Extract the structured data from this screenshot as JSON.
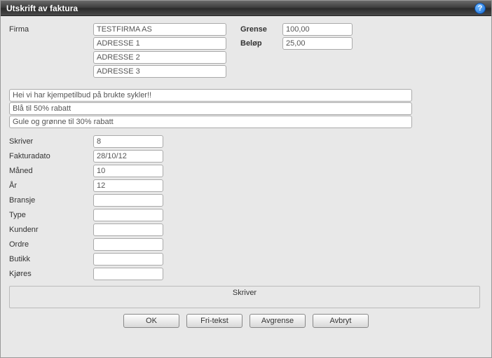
{
  "title": "Utskrift av faktura",
  "help": "?",
  "labels": {
    "firma": "Firma",
    "grense": "Grense",
    "belop": "Beløp",
    "skriver": "Skriver",
    "fakturadato": "Fakturadato",
    "maned": "Måned",
    "ar": "År",
    "bransje": "Bransje",
    "type": "Type",
    "kundenr": "Kundenr",
    "ordre": "Ordre",
    "butikk": "Butikk",
    "kjores": "Kjøres"
  },
  "values": {
    "firma": "TESTFIRMA AS",
    "adresse1": "ADRESSE 1",
    "adresse2": "ADRESSE 2",
    "adresse3": "ADRESSE 3",
    "grense": "100,00",
    "belop": "25,00",
    "freetext1": "Hei vi har kjempetilbud på brukte sykler!!",
    "freetext2": "Blå til 50% rabatt",
    "freetext3": "Gule og grønne til 30% rabatt",
    "skriver": "8",
    "fakturadato": "28/10/12",
    "maned": "10",
    "ar": "12",
    "bransje": "",
    "type": "",
    "kundenr": "",
    "ordre": "",
    "butikk": "",
    "kjores": ""
  },
  "skriver_box": "Skriver",
  "buttons": {
    "ok": "OK",
    "fritekst": "Fri-tekst",
    "avgrense": "Avgrense",
    "avbryt": "Avbryt"
  }
}
